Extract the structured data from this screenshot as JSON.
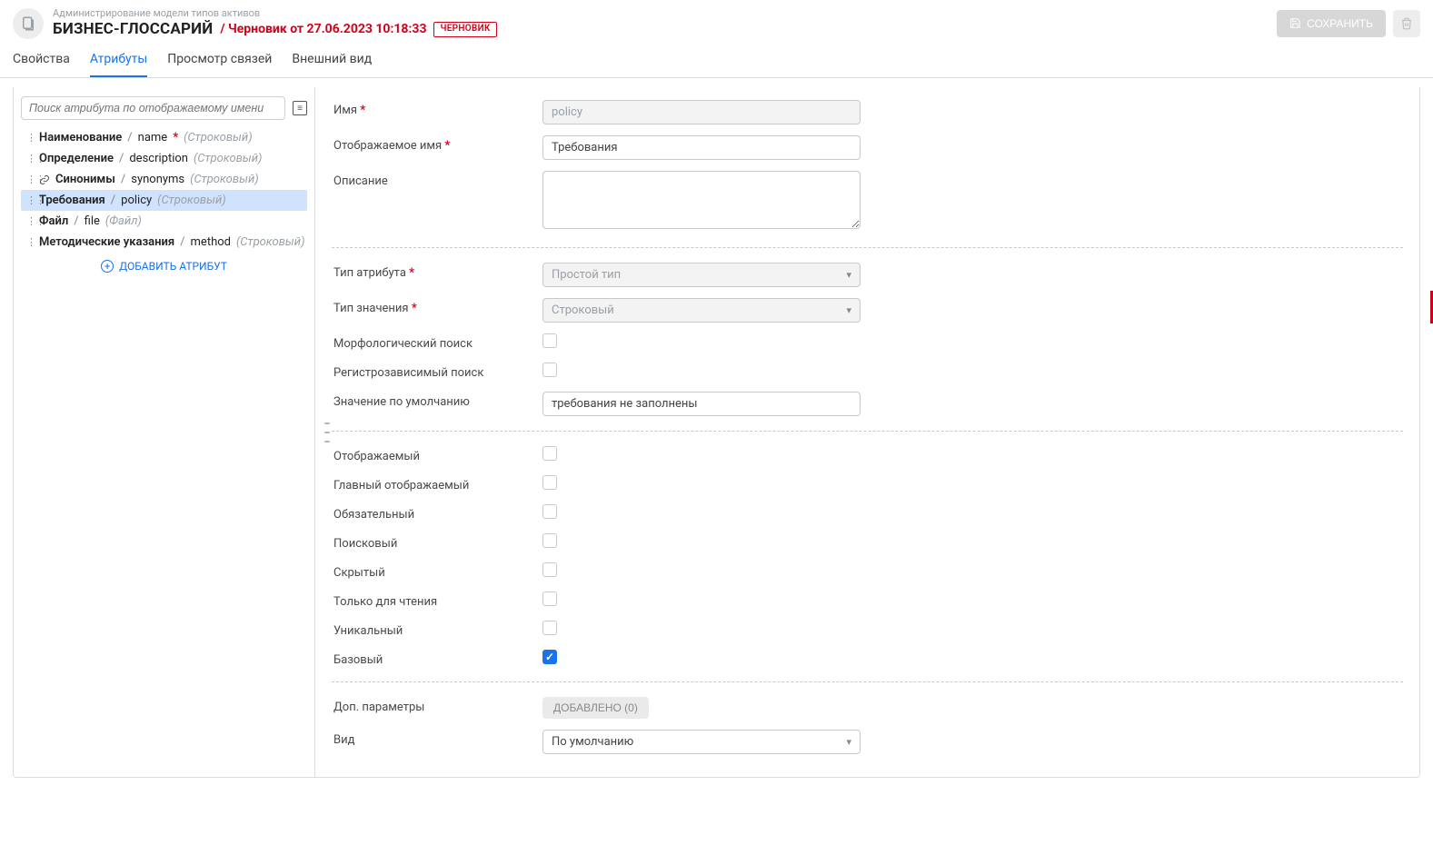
{
  "header": {
    "breadcrumb": "Администрирование модели типов активов",
    "title": "БИЗНЕС-ГЛОССАРИЙ",
    "draft_text": "/ Черновик от 27.06.2023 10:18:33",
    "draft_badge": "ЧЕРНОВИК",
    "save_label": "СОХРАНИТЬ"
  },
  "tabs": [
    {
      "label": "Свойства"
    },
    {
      "label": "Атрибуты"
    },
    {
      "label": "Просмотр связей"
    },
    {
      "label": "Внешний вид"
    }
  ],
  "sidebar": {
    "search_placeholder": "Поиск атрибута по отображаемому имени",
    "add_label": "ДОБАВИТЬ АТРИБУТ",
    "attributes": [
      {
        "name": "Наименование",
        "code": "name",
        "required": true,
        "link": false,
        "type": "(Строковый)"
      },
      {
        "name": "Определение",
        "code": "description",
        "required": false,
        "link": false,
        "type": "(Строковый)"
      },
      {
        "name": "Синонимы",
        "code": "synonyms",
        "required": false,
        "link": true,
        "type": "(Строковый)"
      },
      {
        "name": "Требования",
        "code": "policy",
        "required": false,
        "link": false,
        "type": "(Строковый)",
        "selected": true
      },
      {
        "name": "Файл",
        "code": "file",
        "required": false,
        "link": false,
        "type": "(Файл)"
      },
      {
        "name": "Методические указания",
        "code": "method",
        "required": false,
        "link": false,
        "type": "(Строковый)"
      }
    ]
  },
  "form": {
    "labels": {
      "name": "Имя",
      "display_name": "Отображаемое имя",
      "description": "Описание",
      "attr_type": "Тип атрибута",
      "value_type": "Тип значения",
      "morpho_search": "Морфологический поиск",
      "case_sensitive": "Регистрозависимый поиск",
      "default_value": "Значение по умолчанию",
      "displayed": "Отображаемый",
      "main_displayed": "Главный отображаемый",
      "required": "Обязательный",
      "searchable": "Поисковый",
      "hidden": "Скрытый",
      "read_only": "Только для чтения",
      "unique": "Уникальный",
      "base": "Базовый",
      "extra_params": "Доп. параметры",
      "kind": "Вид"
    },
    "values": {
      "name": "policy",
      "display_name": "Требования",
      "description": "",
      "attr_type": "Простой тип",
      "value_type": "Строковый",
      "default_value": "требования не заполнены",
      "extra_added": "ДОБАВЛЕНО (0)",
      "kind": "По умолчанию"
    },
    "checks": {
      "morpho_search": false,
      "case_sensitive": false,
      "displayed": false,
      "main_displayed": false,
      "required": false,
      "searchable": false,
      "hidden": false,
      "read_only": false,
      "unique": false,
      "base": true
    }
  }
}
